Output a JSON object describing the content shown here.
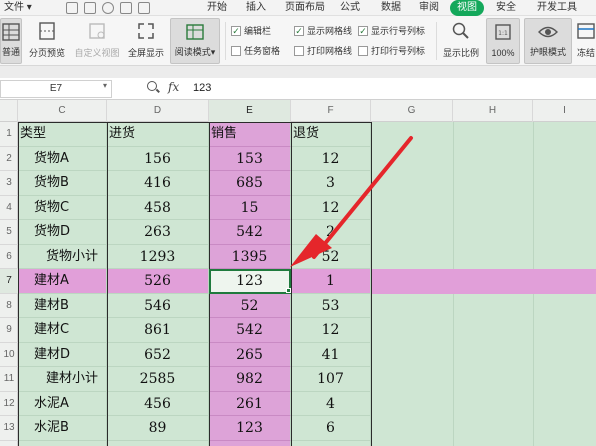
{
  "menubar": {
    "file": "文件",
    "tabs": [
      "开始",
      "插入",
      "页面布局",
      "公式",
      "数据",
      "审阅",
      "视图",
      "安全",
      "开发工具"
    ],
    "active_tab": "视图"
  },
  "ribbon": {
    "normal": "普通",
    "page_break": "分页预览",
    "custom_view": "自定义视图",
    "fullscreen": "全屏显示",
    "reading_mode": "阅读模式",
    "edit_bar": "编辑栏",
    "task_pane": "任务窗格",
    "show_gridlines": "显示网格线",
    "print_gridlines": "打印网格线",
    "show_row_col": "显示行号列标",
    "print_row_col": "打印行号列标",
    "zoom_ratio": "显示比例",
    "zoom_100": "100%",
    "eye_mode": "护眼模式",
    "freeze": "冻结"
  },
  "formula": {
    "name_box": "E7",
    "fx": "fx",
    "value": "123"
  },
  "columns": [
    "C",
    "D",
    "E",
    "F",
    "G",
    "H",
    "I"
  ],
  "rows": [
    "1",
    "2",
    "3",
    "4",
    "5",
    "6",
    "7",
    "8",
    "9",
    "10",
    "11",
    "12",
    "13"
  ],
  "table": {
    "headers": [
      "类型",
      "进货",
      "销售",
      "退货"
    ],
    "data": [
      [
        "货物A",
        "156",
        "153",
        "12"
      ],
      [
        "货物B",
        "416",
        "685",
        "3"
      ],
      [
        "货物C",
        "458",
        "15",
        "12"
      ],
      [
        "货物D",
        "263",
        "542",
        "2"
      ],
      [
        "货物小计",
        "1293",
        "1395",
        "52"
      ],
      [
        "建材A",
        "526",
        "123",
        "1"
      ],
      [
        "建材B",
        "546",
        "52",
        "53"
      ],
      [
        "建材C",
        "861",
        "542",
        "12"
      ],
      [
        "建材D",
        "652",
        "265",
        "41"
      ],
      [
        "建材小计",
        "2585",
        "982",
        "107"
      ],
      [
        "水泥A",
        "456",
        "261",
        "4"
      ],
      [
        "水泥B",
        "89",
        "123",
        "6"
      ]
    ]
  },
  "colors": {
    "accent": "#14a85b",
    "eye_green": "#cfe6d3",
    "highlight": "#dda3d8",
    "arrow": "#e5262b"
  }
}
